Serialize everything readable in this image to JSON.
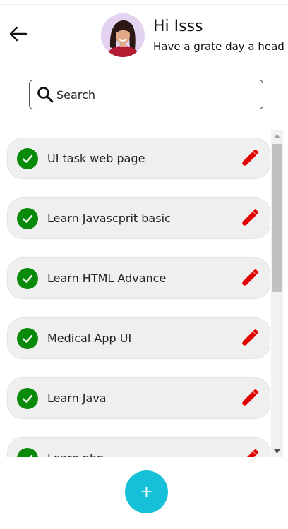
{
  "header": {
    "greeting": "Hi Isss",
    "subtitle": "Have a grate day a head",
    "back_icon": "arrow-left-icon",
    "avatar": "user-avatar"
  },
  "search": {
    "placeholder": "Search",
    "value": "",
    "icon": "search-icon"
  },
  "tasks": [
    {
      "label": "UI task web page",
      "done": true
    },
    {
      "label": "Learn Javascprit basic",
      "done": true
    },
    {
      "label": "Learn HTML Advance",
      "done": true
    },
    {
      "label": "Medical App UI",
      "done": true
    },
    {
      "label": "Learn Java",
      "done": true
    },
    {
      "label": "Learn php",
      "done": true
    }
  ],
  "icons": {
    "check": "check-circle-icon",
    "edit": "pencil-icon"
  },
  "fab": {
    "label": "+"
  },
  "colors": {
    "check": "#0a8a0a",
    "edit": "#e00000",
    "fab": "#16c0d8",
    "task_bg": "#efefef"
  }
}
